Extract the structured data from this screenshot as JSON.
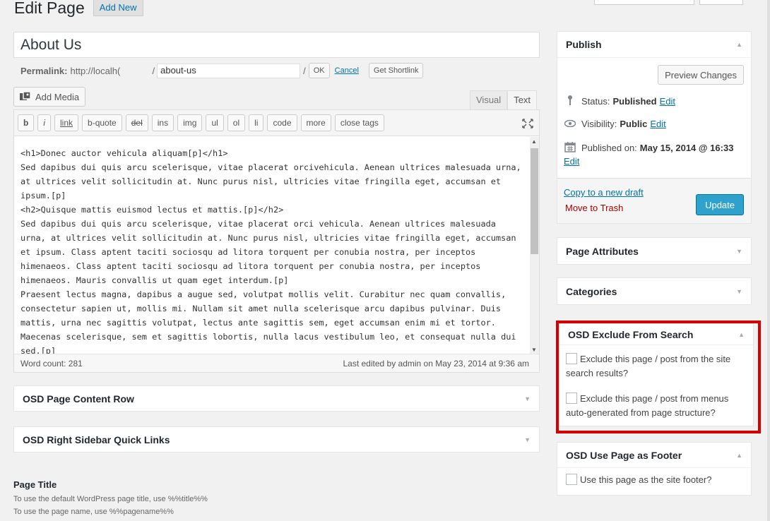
{
  "header": {
    "title": "Edit Page",
    "add_new_label": "Add New"
  },
  "post": {
    "title": "About Us",
    "permalink_label": "Permalink:",
    "permalink_base": "http://localh(",
    "slug": "about-us",
    "ok_label": "OK",
    "cancel_label": "Cancel",
    "shortlink_label": "Get Shortlink"
  },
  "editor": {
    "add_media_label": "Add Media",
    "tabs": [
      "Visual",
      "Text"
    ],
    "toolbar": [
      "b",
      "i",
      "link",
      "b-quote",
      "del",
      "ins",
      "img",
      "ul",
      "ol",
      "li",
      "code",
      "more",
      "close tags"
    ],
    "content": "<h1>Donec auctor vehicula aliquam[p]</h1>\nSed dapibus dui quis arcu scelerisque, vitae placerat orcivehicula. Aenean ultrices malesuada urna, at ultrices velit sollicitudin at. Nunc purus nisl, ultricies vitae fringilla eget, accumsan et ipsum.[p]\n<h2>Quisque mattis euismod lectus et mattis.[p]</h2>\nSed dapibus dui quis arcu scelerisque, vitae placerat orci vehicula. Aenean ultrices malesuada urna, at ultrices velit sollicitudin at. Nunc purus nisl, ultricies vitae fringilla eget, accumsan et ipsum. Class aptent taciti sociosqu ad litora torquent per conubia nostra, per inceptos himenaeos. Class aptent taciti sociosqu ad litora torquent per conubia nostra, per inceptos himenaeos. Mauris convallis ut quam eget interdum.[p]\nPraesent lectus magna, dapibus a augue sed, volutpat mollis velit. Curabitur nec quam convallis, consectetur sapien ut, mollis mi. Nullam sit amet nulla scelerisque arcu dapibus pulvinar. Duis mattis, urna nec sagittis volutpat, lectus ante sagittis sem, eget accumsan enim mi et tortor. Maecenas scelerisque, sem et sagittis lobortis, nulla lacus vestibulum leo, et consequat nulla dui sed.[p]",
    "word_count": "Word count: 281",
    "last_edited": "Last edited by admin on May 23, 2014 at 9:36 am"
  },
  "metaboxes": {
    "page_content_row": "OSD Page Content Row",
    "right_sidebar_links": "OSD Right Sidebar Quick Links"
  },
  "page_title_section": {
    "heading": "Page Title",
    "help_1": "To use the default WordPress page title, use %%title%%",
    "help_2": "To use the page name, use %%pagename%%"
  },
  "publish": {
    "title": "Publish",
    "preview_label": "Preview Changes",
    "status_label": "Status:",
    "status_value": "Published",
    "visibility_label": "Visibility:",
    "visibility_value": "Public",
    "published_on_label": "Published on:",
    "published_on_value": "May 15, 2014 @ 16:33",
    "edit_label": "Edit",
    "copy_draft_label": "Copy to a new draft",
    "trash_label": "Move to Trash",
    "update_label": "Update"
  },
  "sidebar": {
    "page_attributes": "Page Attributes",
    "categories": "Categories",
    "exclude_search": {
      "title": "OSD Exclude From Search",
      "option_1": "Exclude this page / post from the site search results?",
      "option_2": "Exclude this page / post from menus auto-generated from page structure?"
    },
    "footer": {
      "title": "OSD Use Page as Footer",
      "option": "Use this page as the site footer?"
    }
  },
  "colors": {
    "highlight": "#d50000",
    "primary_button": "#2ea2cc",
    "link": "#0073aa"
  }
}
